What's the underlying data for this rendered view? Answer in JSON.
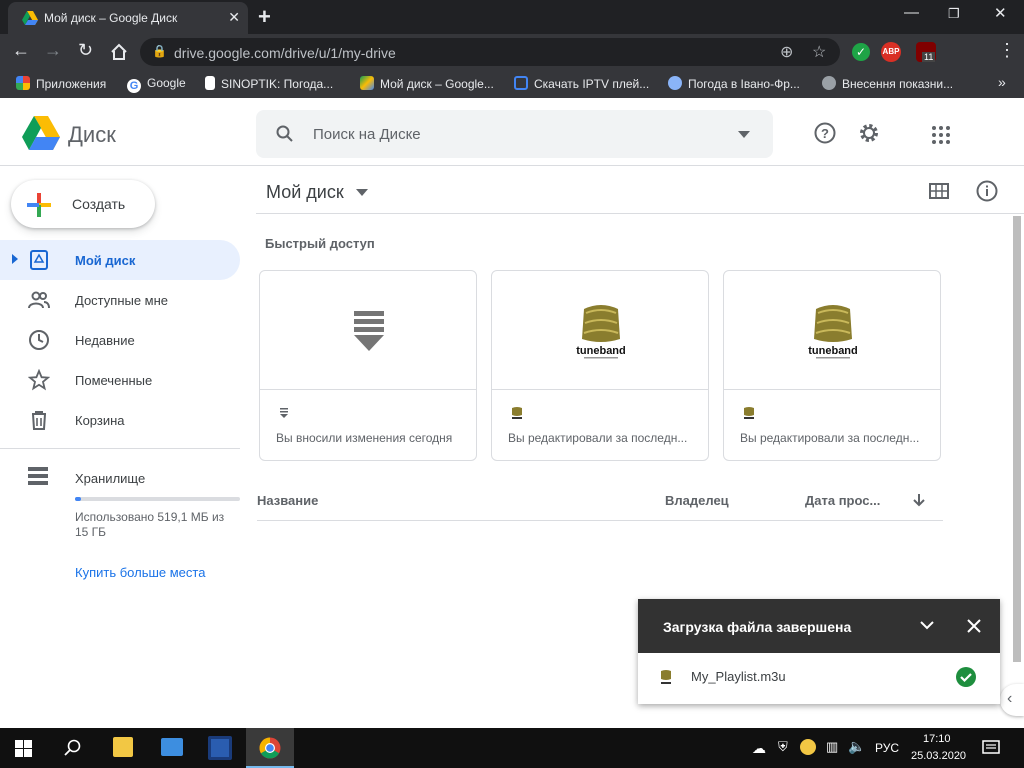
{
  "browser": {
    "tab_title": "Мой диск – Google Диск",
    "url": "drive.google.com/drive/u/1/my-drive",
    "ext_abp": "ABP",
    "ext_ub_count": "11",
    "bookmarks": [
      {
        "label": "Приложения",
        "icon": "apps-grid-icon"
      },
      {
        "label": "Google",
        "icon": "google-icon"
      },
      {
        "label": "SINOPTIK: Погода...",
        "icon": "thermometer-icon"
      },
      {
        "label": "Мой диск – Google...",
        "icon": "drive-icon"
      },
      {
        "label": "Скачать IPTV плей...",
        "icon": "tv-icon"
      },
      {
        "label": "Погода в Івано-Фр...",
        "icon": "weather-icon"
      },
      {
        "label": "Внесення показни...",
        "icon": "globe-icon"
      }
    ]
  },
  "header": {
    "logo_text": "Диск",
    "search_placeholder": "Поиск на Диске"
  },
  "sidebar": {
    "create_label": "Создать",
    "items": [
      {
        "label": "Мой диск",
        "icon": "my-drive-icon",
        "active": true
      },
      {
        "label": "Доступные мне",
        "icon": "shared-icon"
      },
      {
        "label": "Недавние",
        "icon": "recent-icon"
      },
      {
        "label": "Помеченные",
        "icon": "starred-icon"
      },
      {
        "label": "Корзина",
        "icon": "trash-icon"
      }
    ],
    "storage": {
      "label": "Хранилище",
      "used_line1": "Использовано 519,1 МБ из",
      "used_line2": "15 ГБ",
      "used_fraction": 0.034,
      "buy_label": "Купить больше места"
    }
  },
  "main": {
    "title": "Мой диск",
    "quick_access_title": "Быстрый доступ",
    "cards": [
      {
        "desc": "Вы вносили изменения сегодня",
        "thumb": "download-arrow-icon"
      },
      {
        "desc": "Вы редактировали за последн...",
        "thumb": "tuneband-logo",
        "logo_text": "tuneband"
      },
      {
        "desc": "Вы редактировали за последн...",
        "thumb": "tuneband-logo",
        "logo_text": "tuneband"
      }
    ],
    "columns": {
      "name": "Название",
      "owner": "Владелец",
      "date": "Дата прос..."
    }
  },
  "toast": {
    "title": "Загрузка файла завершена",
    "file_name": "My_Playlist.m3u"
  },
  "taskbar": {
    "lang": "РУС",
    "time": "17:10",
    "date": "25.03.2020"
  },
  "colors": {
    "accent": "#1967d2",
    "active_bg": "#e8f0fe",
    "toast_bg": "#323232",
    "success": "#1e8e3e"
  }
}
